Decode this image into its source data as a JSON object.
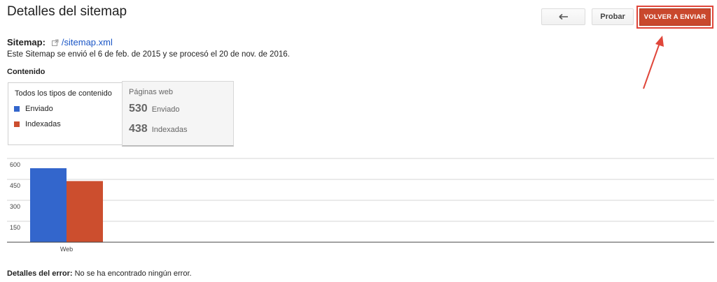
{
  "header": {
    "title": "Detalles del sitemap",
    "back_icon": "back-arrow-icon",
    "test_label": "Probar",
    "resubmit_label": "VOLVER A ENVIAR"
  },
  "sitemap": {
    "label": "Sitemap:",
    "link_icon": "external-link-icon",
    "url": "/sitemap.xml",
    "submitted_text": "Este Sitemap se envió el 6 de feb. de 2015 y se procesó el 20 de nov. de 2016."
  },
  "content": {
    "heading": "Contenido",
    "types_title": "Todos los tipos de contenido",
    "legend": [
      {
        "label": "Enviado",
        "color": "#3366cc"
      },
      {
        "label": "Indexadas",
        "color": "#cc4e2e"
      }
    ],
    "web": {
      "title": "Páginas web",
      "submitted_value": "530",
      "submitted_label": "Enviado",
      "indexed_value": "438",
      "indexed_label": "Indexadas"
    }
  },
  "chart_data": {
    "type": "bar",
    "categories": [
      "Web"
    ],
    "series": [
      {
        "name": "Enviado",
        "values": [
          530
        ],
        "color": "#3366cc"
      },
      {
        "name": "Indexadas",
        "values": [
          438
        ],
        "color": "#cc4e2e"
      }
    ],
    "yticks": [
      150,
      300,
      450,
      600
    ],
    "ylim": [
      0,
      600
    ],
    "grid": true
  },
  "errors": {
    "label": "Detalles del error:",
    "text": "No se ha encontrado ningún error."
  }
}
